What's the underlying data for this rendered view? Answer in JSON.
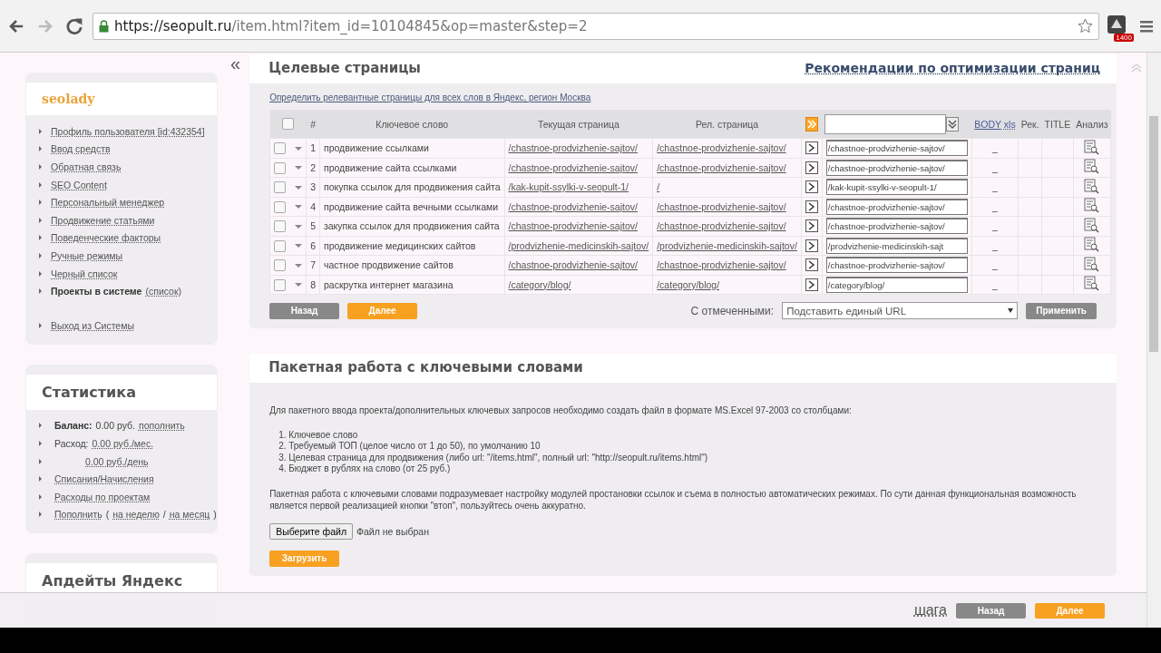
{
  "browser": {
    "url_host": "https://seopult.ru",
    "url_path": "/item.html?item_id=10104845&op=master&step=2",
    "extension_badge": "1400"
  },
  "sidebar": {
    "collapse": "«",
    "user": {
      "title": "seolady",
      "items": [
        {
          "parts": [
            {
              "text": "Профиль пользователя [id:432354]",
              "kind": "link"
            }
          ]
        },
        {
          "parts": [
            {
              "text": "Ввод средств",
              "kind": "link"
            }
          ]
        },
        {
          "parts": [
            {
              "text": "Обратная связь",
              "kind": "link"
            }
          ]
        },
        {
          "parts": [
            {
              "text": "SEO Content",
              "kind": "link"
            }
          ]
        },
        {
          "parts": [
            {
              "text": "Персональный менеджер",
              "kind": "link"
            }
          ]
        },
        {
          "parts": [
            {
              "text": "Продвижение статьями",
              "kind": "link"
            }
          ]
        },
        {
          "parts": [
            {
              "text": "Поведенческие факторы",
              "kind": "link"
            }
          ]
        },
        {
          "parts": [
            {
              "text": "Ручные режимы",
              "kind": "link"
            }
          ]
        },
        {
          "parts": [
            {
              "text": "Черный список",
              "kind": "link"
            }
          ]
        },
        {
          "parts": [
            {
              "text": "Проекты в системе",
              "kind": "bold"
            },
            {
              "text": "(список)",
              "kind": "link"
            }
          ]
        },
        {
          "parts": [
            {
              "text": "Выход из Системы",
              "kind": "link"
            }
          ],
          "separated": true
        }
      ]
    },
    "stats": {
      "title": "Статистика",
      "items": [
        {
          "parts": [
            {
              "text": "Баланс:",
              "kind": "bold"
            },
            {
              "text": "0.00 руб.",
              "kind": "plain"
            },
            {
              "text": "пополнить",
              "kind": "link"
            }
          ]
        },
        {
          "parts": [
            {
              "text": "Расход:",
              "kind": "plain"
            },
            {
              "text": "0.00 руб./мес.",
              "kind": "link"
            }
          ]
        },
        {
          "parts": [
            {
              "text": "0.00 руб./день",
              "kind": "link"
            }
          ],
          "indented": true
        },
        {
          "parts": [
            {
              "text": "Списания/Начисления",
              "kind": "link"
            }
          ]
        },
        {
          "parts": [
            {
              "text": "Расходы по проектам",
              "kind": "link"
            }
          ]
        },
        {
          "parts": [
            {
              "text": "Пополнить",
              "kind": "link"
            },
            {
              "text": "(",
              "kind": "plain"
            },
            {
              "text": "на неделю",
              "kind": "link"
            },
            {
              "text": "/",
              "kind": "plain"
            },
            {
              "text": "на месяц",
              "kind": "link"
            },
            {
              "text": ")",
              "kind": "plain"
            }
          ]
        }
      ]
    },
    "updates": {
      "title": "Апдейты Яндекс"
    }
  },
  "targets": {
    "title": "Целевые страницы",
    "recommend_link": "Рекомендации по оптимизации страниц",
    "detect_link": "Определить релевантные страницы для всех слов в Яндекс, регион Москва",
    "columns": {
      "number": "#",
      "keyword": "Ключевое слово",
      "current": "Текущая страница",
      "relevant": "Рел. страница",
      "body": "BODY",
      "xls": "xls",
      "rec": "Рек.",
      "title": "TITLE",
      "analysis": "Анализ"
    },
    "header_checked": false,
    "rows": [
      {
        "checked": false,
        "number": "1",
        "keyword": "продвижение ссылками",
        "current": "/chastnoe-prodvizhenie-sajtov/",
        "relevant": "/chastnoe-prodvizhenie-sajtov/",
        "target": "/chastnoe-prodvizhenie-sajtov/",
        "body": "_"
      },
      {
        "checked": false,
        "number": "2",
        "keyword": "продвижение сайта ссылками",
        "current": "/chastnoe-prodvizhenie-sajtov/",
        "relevant": "/chastnoe-prodvizhenie-sajtov/",
        "target": "/chastnoe-prodvizhenie-sajtov/",
        "body": "_"
      },
      {
        "checked": false,
        "number": "3",
        "keyword": "покупка ссылок для продвижения сайта",
        "current": "/kak-kupit-ssylki-v-seopult-1/",
        "relevant": "/",
        "target": "/kak-kupit-ssylki-v-seopult-1/",
        "body": "_"
      },
      {
        "checked": false,
        "number": "4",
        "keyword": "продвижение сайта вечными ссылками",
        "current": "/chastnoe-prodvizhenie-sajtov/",
        "relevant": "/chastnoe-prodvizhenie-sajtov/",
        "target": "/chastnoe-prodvizhenie-sajtov/",
        "body": "_"
      },
      {
        "checked": false,
        "number": "5",
        "keyword": "закупка ссылок для продвижения сайта",
        "current": "/chastnoe-prodvizhenie-sajtov/",
        "relevant": "/chastnoe-prodvizhenie-sajtov/",
        "target": "/chastnoe-prodvizhenie-sajtov/",
        "body": "_"
      },
      {
        "checked": false,
        "number": "6",
        "keyword": "продвижение медицинских сайтов",
        "current": "/prodvizhenie-medicinskih-sajtov/",
        "relevant": "/prodvizhenie-medicinskih-sajtov/",
        "target": "/prodvizhenie-medicinskih-sajt",
        "body": "_"
      },
      {
        "checked": false,
        "number": "7",
        "keyword": "частное продвижение сайтов",
        "current": "/chastnoe-prodvizhenie-sajtov/",
        "relevant": "/chastnoe-prodvizhenie-sajtov/",
        "target": "/chastnoe-prodvizhenie-sajtov/",
        "body": "_"
      },
      {
        "checked": false,
        "number": "8",
        "keyword": "раскрутка интернет магазина",
        "current": "/category/blog/",
        "relevant": "/category/blog/",
        "target": "/category/blog/",
        "body": "_"
      }
    ],
    "back_button": "Назад",
    "next_button": "Далее",
    "with_selected_label": "С отмеченными:",
    "bulk_action": "Подставить единый URL",
    "apply_button": "Применить"
  },
  "batch": {
    "title": "Пакетная работа с ключевыми словами",
    "intro": "Для пакетного ввода проекта/дополнительных ключевых запросов необходимо создать файл в формате MS.Excel 97-2003 со столбцами:",
    "columns": [
      "1. Ключевое слово",
      "2. Требуемый ТОП (целое число от 1 до 50), по умолчанию 10",
      "3. Целевая страница для продвижения (либо url: \"/items.html\", полный url: \"http://seopult.ru/items.html\")",
      "4. Бюджет в рублях на слово (от 25 руб.)"
    ],
    "note": "Пакетная работа с ключевыми словами подразумевает настройку модулей простановки ссылок и съема в полностью автоматических режимах. По сути данная функциональная возможность является первой реализацией кнопки \"втоп\", пользуйтесь очень аккуратно.",
    "file_button": "Выберите файл",
    "file_status": "Файл не выбран",
    "upload_button": "Загрузить"
  },
  "footer_bar": {
    "step_link": "шага",
    "back_button": "Назад",
    "next_button": "Далее"
  }
}
